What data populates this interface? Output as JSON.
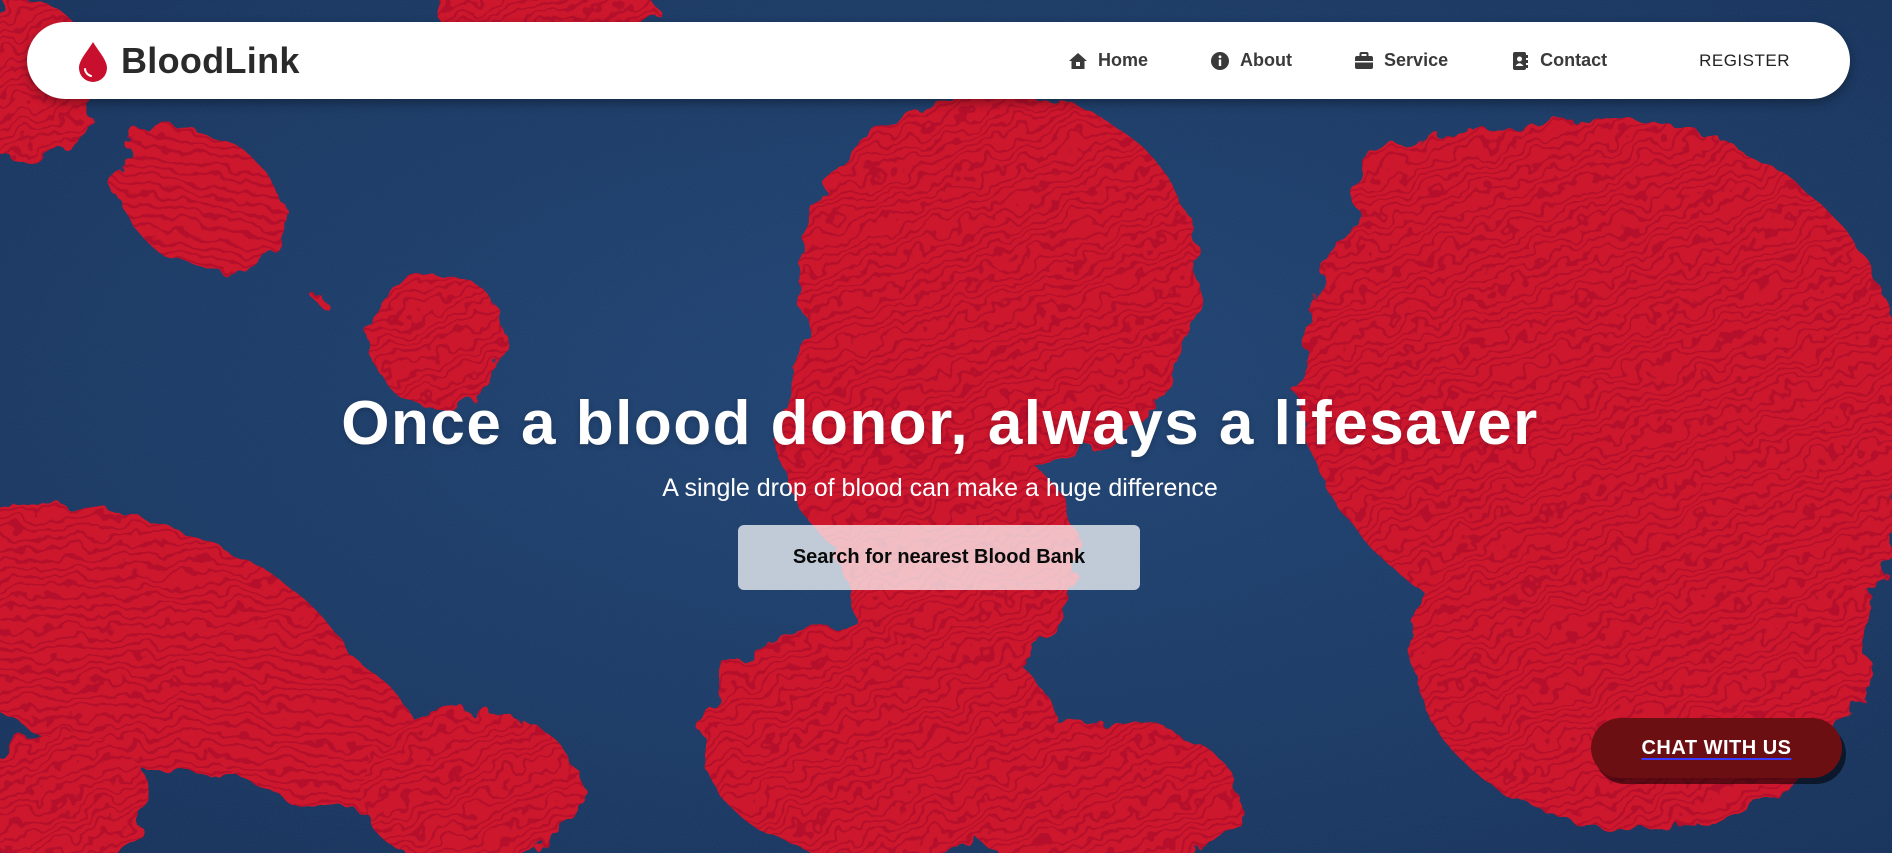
{
  "brand": {
    "name": "BloodLink",
    "logo_icon": "blood-drop-icon",
    "logo_color": "#c8102e"
  },
  "nav": {
    "items": [
      {
        "label": "Home",
        "icon": "home-icon"
      },
      {
        "label": "About",
        "icon": "info-icon"
      },
      {
        "label": "Service",
        "icon": "briefcase-icon"
      },
      {
        "label": "Contact",
        "icon": "address-book-icon"
      }
    ],
    "register_label": "REGISTER"
  },
  "hero": {
    "title": "Once a blood donor, always a lifesaver",
    "subtitle": "A single drop of blood can make a huge difference",
    "search_button_label": "Search for nearest Blood Bank"
  },
  "chat": {
    "label": "CHAT WITH US",
    "color": "#6b0f12"
  },
  "colors": {
    "background_blue": "#1c3d6b",
    "blood_red": "#e8142a",
    "navbar_bg": "#ffffff"
  }
}
